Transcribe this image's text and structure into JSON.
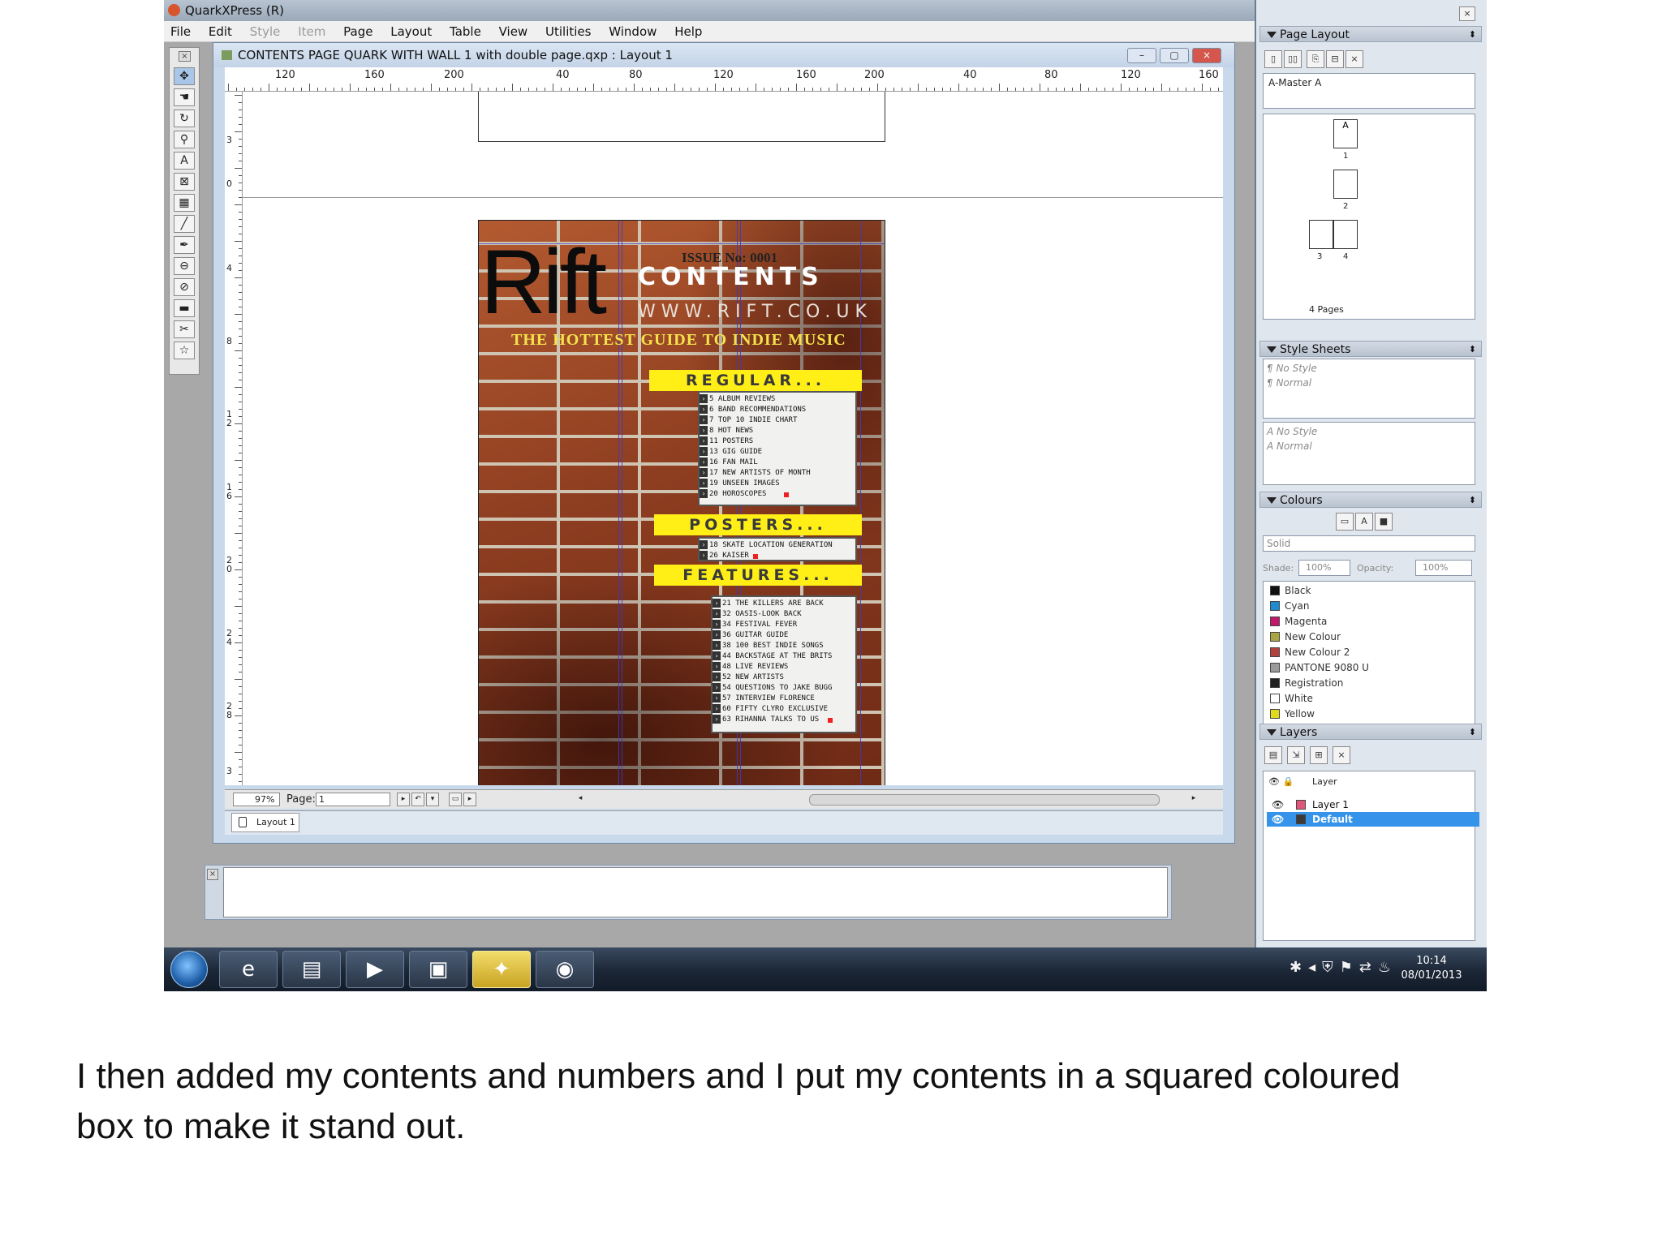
{
  "app": {
    "title": "QuarkXPress (R)",
    "menu": [
      "File",
      "Edit",
      "Style",
      "Item",
      "Page",
      "Layout",
      "Table",
      "View",
      "Utilities",
      "Window",
      "Help"
    ],
    "menu_disabled": [
      "Style",
      "Item"
    ]
  },
  "toolbox": {
    "tools": [
      "item-tool",
      "hand-tool",
      "rotate-tool",
      "zoom-tool",
      "text-box-tool",
      "picture-box-tool",
      "table-tool",
      "line-tool",
      "pen-tool",
      "linking-tool",
      "unlinking-tool",
      "composition-zone-tool",
      "scissors-tool",
      "star-tool"
    ]
  },
  "document": {
    "title": "CONTENTS PAGE QUARK WITH WALL 1 with double page.qxp : Layout 1",
    "ruler_h_labels": [
      "120",
      "160",
      "200",
      "40",
      "80",
      "120",
      "160",
      "200",
      "40",
      "80",
      "120",
      "160"
    ],
    "ruler_v_labels": [
      "3",
      "0",
      "4",
      "8",
      "12",
      "16",
      "20",
      "24",
      "28",
      "3"
    ],
    "zoom": "97%",
    "page_label": "Page:",
    "page_value": "1",
    "layout_tab": "Layout 1"
  },
  "page": {
    "logo": "Rift",
    "issue": "ISSUE No: 0001",
    "contents_heading": "CONTENTS",
    "website": "WWW.RIFT.CO.UK",
    "tagline": "THE HOTTEST GUIDE TO INDIE MUSIC",
    "regulars": {
      "heading": "REGULAR...",
      "items": [
        "ALBUM REVIEWS",
        "BAND RECOMMENDATIONS",
        "TOP 10 INDIE CHART",
        "HOT NEWS",
        "POSTERS",
        "GIG GUIDE",
        "FAN MAIL",
        "NEW ARTISTS OF MONTH",
        "UNSEEN IMAGES",
        "HOROSCOPES"
      ],
      "numbers": [
        "5",
        "6",
        "7",
        "8",
        "11",
        "13",
        "16",
        "17",
        "19",
        "20"
      ]
    },
    "posters": {
      "heading": "POSTERS...",
      "items": [
        "SKATE LOCATION GENERATION",
        "KAISER"
      ],
      "numbers": [
        "18",
        "26"
      ]
    },
    "features": {
      "heading": "FEATURES...",
      "items": [
        "THE KILLERS ARE BACK",
        "OASIS-LOOK BACK",
        "FESTIVAL FEVER",
        "GUITAR GUIDE",
        "100 BEST INDIE SONGS",
        "BACKSTAGE AT THE BRITS",
        "LIVE REVIEWS",
        "NEW ARTISTS",
        "QUESTIONS TO JAKE BUGG",
        "INTERVIEW FLORENCE",
        "FIFTY CLYRO EXCLUSIVE",
        "RIHANNA TALKS TO US"
      ],
      "numbers": [
        "21",
        "32",
        "34",
        "36",
        "38",
        "44",
        "48",
        "52",
        "54",
        "57",
        "60",
        "63"
      ]
    }
  },
  "palettes": {
    "page_layout": {
      "title": "Page Layout",
      "master": "A-Master A",
      "master_letter": "A",
      "page_numbers": [
        "1",
        "2",
        "3",
        "4"
      ],
      "pages_count": "4 Pages"
    },
    "style_sheets": {
      "title": "Style Sheets",
      "paragraph": [
        "No Style",
        "Normal"
      ],
      "character": [
        "No Style",
        "Normal"
      ]
    },
    "colours": {
      "title": "Colours",
      "fill_type": "Solid",
      "shade_label": "Shade:",
      "shade": "100%",
      "opacity_label": "Opacity:",
      "opacity": "100%",
      "list": [
        {
          "name": "Black",
          "color": "#111111"
        },
        {
          "name": "Cyan",
          "color": "#1e8ad0"
        },
        {
          "name": "Magenta",
          "color": "#c2186b"
        },
        {
          "name": "New Colour",
          "color": "#a8a640"
        },
        {
          "name": "New Colour 2",
          "color": "#b3403c"
        },
        {
          "name": "PANTONE 9080 U",
          "color": "#9a9a9a"
        },
        {
          "name": "Registration",
          "color": "#222222"
        },
        {
          "name": "White",
          "color": "#ffffff"
        },
        {
          "name": "Yellow",
          "color": "#e0da1e"
        }
      ]
    },
    "layers": {
      "title": "Layers",
      "column_label": "Layer",
      "list": [
        {
          "name": "Layer 1",
          "color": "#e0567a",
          "selected": false
        },
        {
          "name": "Default",
          "color": "#3a3a3a",
          "selected": true
        }
      ]
    }
  },
  "taskbar": {
    "items": [
      "start-button",
      "internet-explorer",
      "file-explorer",
      "media-player",
      "powerpoint",
      "quarkxpress",
      "chrome"
    ],
    "time": "10:14",
    "date": "08/01/2013"
  },
  "caption": "I then added my contents and numbers and I put my contents in a squared coloured box to make it stand out."
}
